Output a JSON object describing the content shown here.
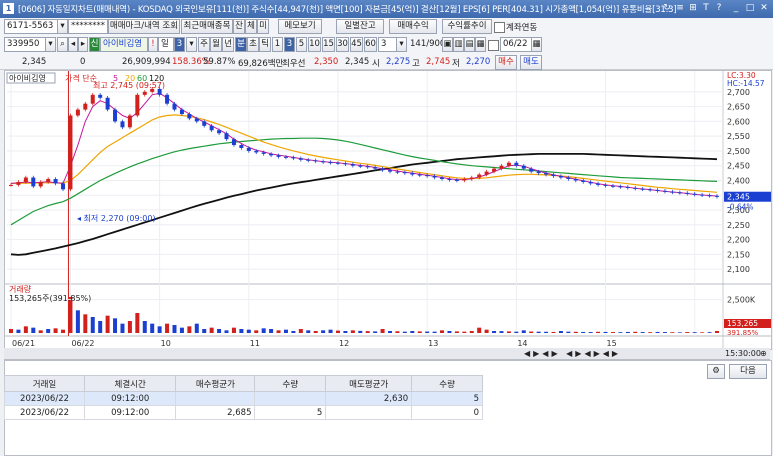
{
  "title": {
    "window_number": "1",
    "text": "[0606] 자동일지차트(매매내역) - KOSDAQ 외국인보유[111(천)] 주식수[44,947(천)] 액면[100] 자본금[45(억)] 결산[12월] EPS[6] PER[404.31] 시가총액[1,054(억)] 유통비율[31.3]",
    "icons": [
      "refresh-icon",
      "menu-icon",
      "pin-icon",
      "font-icon",
      "help-icon",
      "minimize-icon",
      "maximize-icon",
      "close-icon"
    ],
    "icon_glyphs": [
      "↻",
      "≡",
      "⊞",
      "T",
      "?",
      "_",
      "□",
      "✕"
    ]
  },
  "toolbar1": {
    "account": "6171-5563",
    "password": "********",
    "buttons": [
      "매매마크/내역 조회",
      "최근매매종목",
      "잔",
      "체",
      "미",
      "메모보기",
      "일별잔고",
      "매매수익",
      "수익률추이"
    ],
    "checkbox_label": "계좌연동"
  },
  "toolbar2": {
    "code": "339950",
    "credit_badge": "신",
    "name": "아이비김영",
    "warn_badge": "!",
    "chart_type_label": "일",
    "period_value": "3",
    "periods": [
      "주",
      "월",
      "년",
      "분",
      "초",
      "틱",
      "1",
      "3",
      "5",
      "10",
      "15",
      "30",
      "45",
      "60"
    ],
    "selected_period": "분",
    "selected_minute": "3",
    "minute_value": "3",
    "count": "141/900",
    "date": "06/22"
  },
  "quote": {
    "price": "2,345",
    "change": "0",
    "volume": "26,909,994",
    "volume_ratio": "158.36%",
    "rate": "59.87%",
    "amount": "69,826백만",
    "priority_ask_label": "최우선",
    "priority_ask": "2,350",
    "priority_bid": "2,345",
    "open_label": "시",
    "open": "2,275",
    "high_label": "고",
    "high": "2,745",
    "low_label": "저",
    "low": "2,270",
    "buy_label": "매수",
    "sell_label": "매도"
  },
  "chart_data": {
    "type": "line",
    "title": "아이비김영",
    "legend": {
      "label": "가격 단순",
      "periods": [
        "5",
        "20",
        "60",
        "120"
      ],
      "colors": [
        "#c2179e",
        "#f0a500",
        "#1e9b3a",
        "#111111"
      ]
    },
    "price_axis_ticks": [
      2700,
      2650,
      2600,
      2550,
      2500,
      2450,
      2400,
      2350,
      2300,
      2250,
      2200,
      2150,
      2100
    ],
    "price_ylim": [
      2080,
      2730
    ],
    "lc_label": "LC:3.30",
    "hc_label": "HC:-14.57",
    "current_price_label": "2,345",
    "current_change_label": "-0.64%",
    "high_annotation": "최고 2,745 (09:57)",
    "low_annotation": "최저 2,270 (09:00)",
    "x_labels": [
      "06/21",
      "06/22",
      "10",
      "11",
      "12",
      "13",
      "14",
      "15",
      "15:30:00"
    ],
    "close_series": [
      2385,
      2395,
      2410,
      2380,
      2395,
      2405,
      2390,
      2370,
      2620,
      2640,
      2660,
      2690,
      2680,
      2640,
      2600,
      2580,
      2620,
      2690,
      2700,
      2710,
      2690,
      2660,
      2640,
      2625,
      2610,
      2600,
      2585,
      2570,
      2560,
      2540,
      2520,
      2510,
      2500,
      2495,
      2490,
      2485,
      2480,
      2478,
      2475,
      2470,
      2468,
      2465,
      2462,
      2460,
      2458,
      2455,
      2450,
      2448,
      2445,
      2440,
      2435,
      2430,
      2428,
      2425,
      2420,
      2418,
      2415,
      2410,
      2405,
      2402,
      2400,
      2405,
      2410,
      2420,
      2430,
      2440,
      2450,
      2460,
      2450,
      2440,
      2430,
      2425,
      2420,
      2415,
      2410,
      2405,
      2400,
      2395,
      2390,
      2385,
      2382,
      2380,
      2378,
      2375,
      2372,
      2370,
      2368,
      2365,
      2362,
      2360,
      2358,
      2355,
      2352,
      2350,
      2348,
      2345
    ],
    "ma5": [
      2390,
      2392,
      2395,
      2392,
      2394,
      2396,
      2392,
      2390,
      2450,
      2520,
      2600,
      2650,
      2670,
      2660,
      2640,
      2620,
      2610,
      2630,
      2660,
      2690,
      2695,
      2680,
      2660,
      2640,
      2625,
      2610,
      2598,
      2585,
      2572,
      2558,
      2540,
      2525,
      2512,
      2503,
      2497,
      2490,
      2486,
      2482,
      2478,
      2474,
      2470,
      2467,
      2464,
      2462,
      2460,
      2457,
      2454,
      2451,
      2448,
      2444,
      2440,
      2436,
      2432,
      2428,
      2425,
      2421,
      2418,
      2414,
      2410,
      2406,
      2403,
      2403,
      2406,
      2412,
      2420,
      2430,
      2440,
      2450,
      2452,
      2448,
      2440,
      2432,
      2425,
      2419,
      2414,
      2409,
      2404,
      2399,
      2394,
      2389,
      2385,
      2382,
      2380,
      2377,
      2374,
      2371,
      2369,
      2366,
      2363,
      2361,
      2359,
      2356,
      2353,
      2351,
      2349,
      2347
    ],
    "ma20": [
      2390,
      2390,
      2391,
      2391,
      2392,
      2392,
      2392,
      2391,
      2400,
      2420,
      2445,
      2470,
      2495,
      2515,
      2530,
      2545,
      2560,
      2575,
      2590,
      2605,
      2615,
      2620,
      2622,
      2620,
      2617,
      2612,
      2606,
      2598,
      2590,
      2580,
      2570,
      2560,
      2550,
      2540,
      2530,
      2522,
      2514,
      2507,
      2500,
      2494,
      2488,
      2483,
      2478,
      2474,
      2470,
      2466,
      2462,
      2458,
      2455,
      2451,
      2447,
      2443,
      2439,
      2435,
      2431,
      2427,
      2423,
      2420,
      2416,
      2412,
      2409,
      2407,
      2406,
      2407,
      2409,
      2412,
      2415,
      2418,
      2420,
      2421,
      2421,
      2420,
      2419,
      2417,
      2415,
      2413,
      2410,
      2407,
      2404,
      2401,
      2398,
      2395,
      2392,
      2389,
      2386,
      2383,
      2380,
      2377,
      2375,
      2372,
      2370,
      2368,
      2366,
      2364,
      2362,
      2360
    ],
    "ma60": [
      2250,
      2265,
      2280,
      2295,
      2305,
      2315,
      2322,
      2328,
      2340,
      2355,
      2370,
      2385,
      2400,
      2412,
      2424,
      2435,
      2446,
      2456,
      2465,
      2474,
      2482,
      2490,
      2497,
      2503,
      2508,
      2512,
      2516,
      2520,
      2524,
      2527,
      2530,
      2532,
      2534,
      2536,
      2538,
      2540,
      2541,
      2542,
      2542,
      2543,
      2543,
      2543,
      2542,
      2540,
      2537,
      2533,
      2528,
      2522,
      2516,
      2510,
      2504,
      2498,
      2492,
      2486,
      2481,
      2476,
      2472,
      2468,
      2464,
      2460,
      2456,
      2453,
      2450,
      2448,
      2446,
      2444,
      2442,
      2440,
      2438,
      2436,
      2434,
      2432,
      2430,
      2428,
      2426,
      2424,
      2422,
      2420,
      2418,
      2416,
      2414,
      2412,
      2410,
      2409,
      2408,
      2407,
      2406,
      2405,
      2404,
      2403,
      2402,
      2401,
      2400,
      2399,
      2398,
      2397
    ],
    "ma120": [
      2150,
      2148,
      2150,
      2155,
      2160,
      2165,
      2170,
      2176,
      2182,
      2188,
      2195,
      2202,
      2210,
      2218,
      2226,
      2234,
      2242,
      2250,
      2258,
      2266,
      2274,
      2282,
      2290,
      2298,
      2306,
      2314,
      2321,
      2328,
      2335,
      2342,
      2348,
      2354,
      2360,
      2366,
      2371,
      2376,
      2381,
      2386,
      2390,
      2394,
      2398,
      2402,
      2406,
      2410,
      2414,
      2418,
      2422,
      2426,
      2430,
      2434,
      2438,
      2442,
      2446,
      2450,
      2454,
      2457,
      2460,
      2463,
      2466,
      2469,
      2472,
      2474,
      2476,
      2478,
      2480,
      2482,
      2484,
      2486,
      2487,
      2488,
      2489,
      2490,
      2490,
      2490,
      2490,
      2490,
      2490,
      2490,
      2489,
      2488,
      2487,
      2486,
      2485,
      2484,
      2483,
      2482,
      2481,
      2480,
      2479,
      2478,
      2477,
      2476,
      2475,
      2474,
      2473,
      2472
    ],
    "volume_title": "거래량",
    "volume_label": "153,265주(391.85%)",
    "volume_axis_tick": "2,500K",
    "volume_current_label": "153,265",
    "volume_current_pct": "391.85%",
    "volume_ylim": [
      0,
      3000
    ],
    "volume": [
      300,
      250,
      500,
      400,
      200,
      300,
      350,
      250,
      2700,
      1700,
      1400,
      1200,
      900,
      1300,
      1100,
      700,
      900,
      1500,
      900,
      700,
      500,
      700,
      600,
      400,
      500,
      700,
      300,
      400,
      300,
      200,
      400,
      300,
      250,
      200,
      350,
      300,
      200,
      250,
      150,
      300,
      200,
      150,
      200,
      250,
      180,
      150,
      200,
      160,
      140,
      120,
      300,
      150,
      130,
      100,
      150,
      120,
      110,
      100,
      200,
      150,
      120,
      100,
      150,
      400,
      250,
      150,
      140,
      120,
      100,
      200,
      110,
      100,
      90,
      80,
      150,
      100,
      90,
      80,
      70,
      90,
      80,
      70,
      60,
      80,
      90,
      70,
      60,
      80,
      70,
      60,
      50,
      70,
      60,
      50,
      60,
      153
    ],
    "volume_colors": [
      "r",
      "b",
      "r",
      "b",
      "r",
      "b",
      "r",
      "r",
      "r",
      "b",
      "r",
      "b",
      "b",
      "r",
      "b",
      "b",
      "r",
      "r",
      "b",
      "b",
      "b",
      "r",
      "b",
      "b",
      "r",
      "b",
      "b",
      "r",
      "b",
      "b",
      "r",
      "b",
      "b",
      "r",
      "b",
      "b",
      "r",
      "b",
      "b",
      "r",
      "b",
      "r",
      "b",
      "b",
      "r",
      "b",
      "r",
      "b",
      "r",
      "b",
      "r",
      "b",
      "r",
      "b",
      "b",
      "r",
      "b",
      "b",
      "r",
      "b",
      "r",
      "r",
      "r",
      "r",
      "r",
      "b",
      "b",
      "r",
      "b",
      "b",
      "r",
      "b",
      "b",
      "r",
      "b",
      "b",
      "r",
      "b",
      "b",
      "r",
      "b",
      "r",
      "b",
      "b",
      "r",
      "b",
      "r",
      "b",
      "b",
      "r",
      "b",
      "r",
      "b",
      "r",
      "b",
      "r"
    ]
  },
  "chart_toolbar": {
    "zoom_icons": [
      "zoom-in-icon",
      "zoom-out-icon"
    ],
    "time": "15:30:00"
  },
  "trades": {
    "gear_label": "⚙",
    "next_label": "다음",
    "columns": [
      "거래일",
      "체결시간",
      "매수평균가",
      "수량",
      "매도평균가",
      "수량"
    ],
    "rows": [
      [
        "2023/06/22",
        "09:12:00",
        "",
        "",
        "2,630",
        "5"
      ],
      [
        "2023/06/22",
        "09:12:00",
        "2,685",
        "5",
        "",
        "0"
      ]
    ]
  }
}
